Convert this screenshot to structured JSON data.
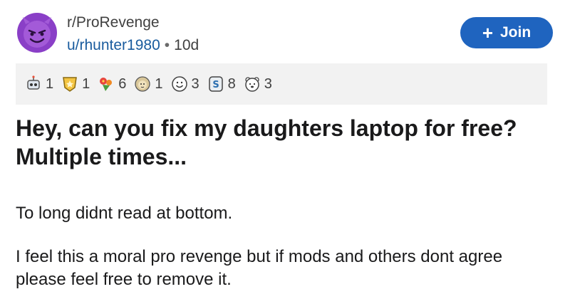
{
  "header": {
    "subreddit": "r/ProRevenge",
    "username": "u/rhunter1980",
    "separator": "•",
    "age": "10d",
    "join_label": "Join",
    "join_icon": "+",
    "avatar_icon": "devil-face-icon",
    "accent_color": "#1f64bf"
  },
  "awards": [
    {
      "icon": "award-robot-icon",
      "count": "1"
    },
    {
      "icon": "award-medal-icon",
      "count": "1"
    },
    {
      "icon": "award-flowers-icon",
      "count": "6"
    },
    {
      "icon": "award-lion-icon",
      "count": "1"
    },
    {
      "icon": "award-smile-icon",
      "count": "3"
    },
    {
      "icon": "award-money-icon",
      "count": "8"
    },
    {
      "icon": "award-bear-icon",
      "count": "3"
    }
  ],
  "post": {
    "title": "Hey, can you fix my daughters laptop for free? Multiple times...",
    "paragraphs": [
      "To long didnt read at bottom.",
      "I feel this a moral pro revenge but if mods and others dont agree please feel free to remove it."
    ]
  }
}
